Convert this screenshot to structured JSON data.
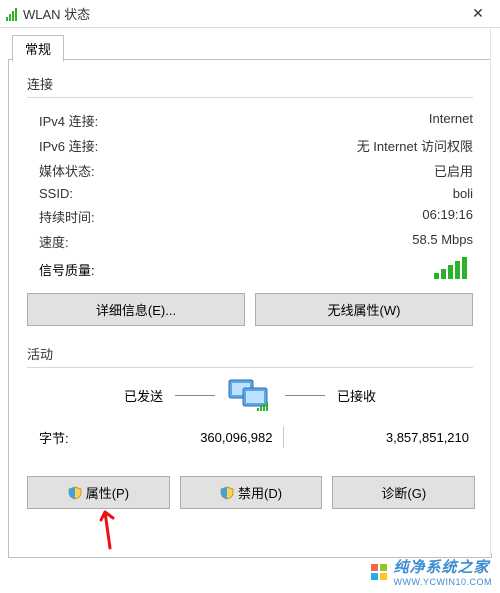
{
  "window": {
    "title": "WLAN 状态"
  },
  "tab": {
    "general": "常规"
  },
  "connection": {
    "heading": "连接",
    "rows": {
      "ipv4_label": "IPv4 连接:",
      "ipv4_value": "Internet",
      "ipv6_label": "IPv6 连接:",
      "ipv6_value": "无 Internet 访问权限",
      "media_label": "媒体状态:",
      "media_value": "已启用",
      "ssid_label": "SSID:",
      "ssid_value": "boli",
      "duration_label": "持续时间:",
      "duration_value": "06:19:16",
      "speed_label": "速度:",
      "speed_value": "58.5 Mbps",
      "signal_label": "信号质量:"
    },
    "buttons": {
      "details": "详细信息(E)...",
      "wireless_props": "无线属性(W)"
    }
  },
  "activity": {
    "heading": "活动",
    "sent_label": "已发送",
    "recv_label": "已接收",
    "bytes_label": "字节:",
    "bytes_sent": "360,096,982",
    "bytes_recv": "3,857,851,210"
  },
  "bottom": {
    "properties": "属性(P)",
    "disable": "禁用(D)",
    "diagnose": "诊断(G)"
  },
  "watermark": {
    "text": "纯净系统之家",
    "url": "WWW.YCWIN10.COM"
  }
}
